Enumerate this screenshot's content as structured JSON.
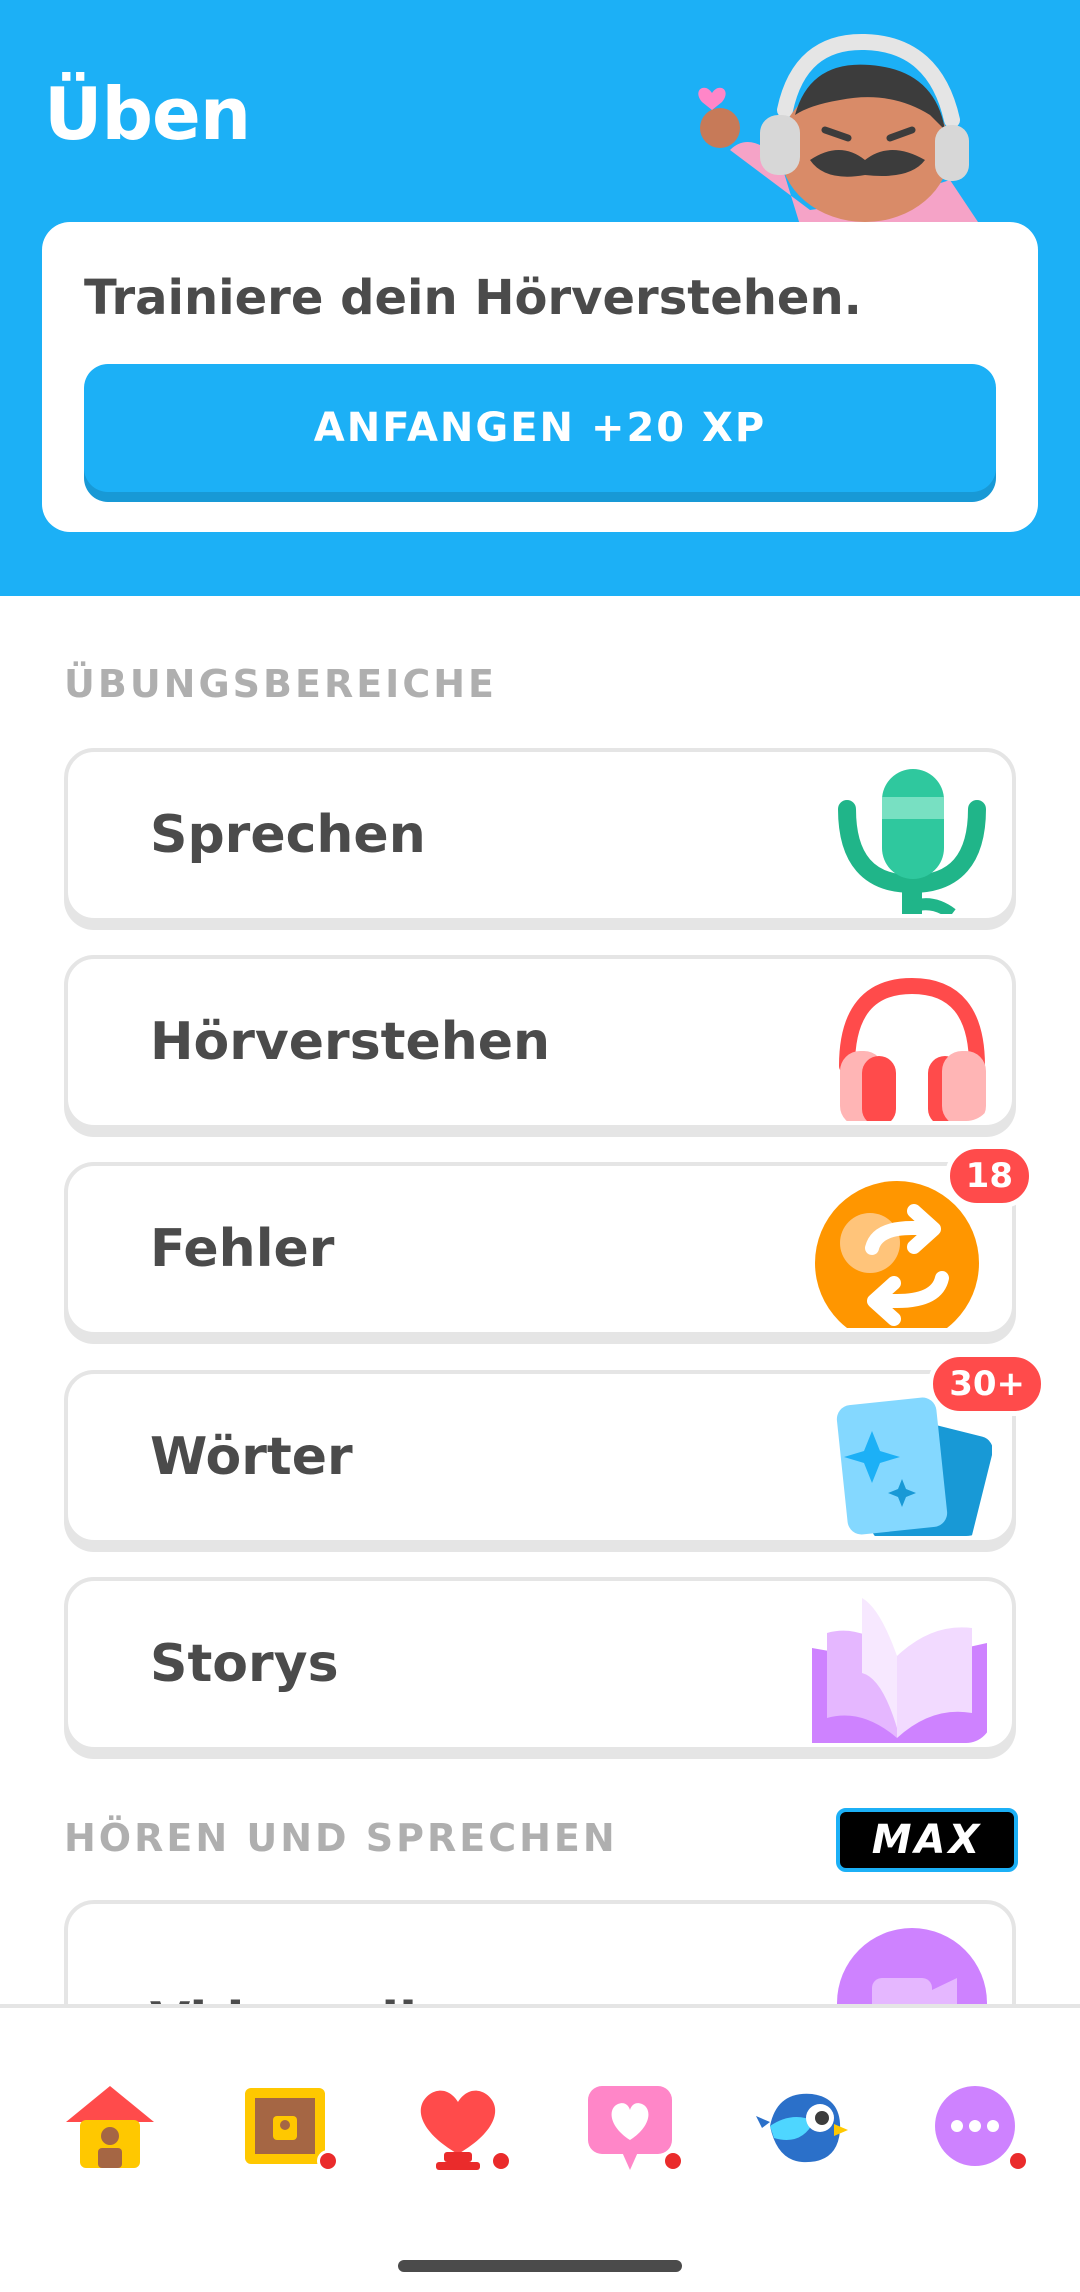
{
  "header": {
    "title": "Üben",
    "promo_text": "Trainiere dein Hörverstehen.",
    "promo_button": "ANFANGEN +20 XP"
  },
  "sections": {
    "practice_label": "ÜBUNGSBEREICHE",
    "listen_speak_label": "HÖREN UND SPRECHEN",
    "max_label": "MAX"
  },
  "cards": [
    {
      "label": "Sprechen",
      "icon": "microphone-icon"
    },
    {
      "label": "Hörverstehen",
      "icon": "headphones-icon"
    },
    {
      "label": "Fehler",
      "icon": "repeat-icon",
      "badge": "18"
    },
    {
      "label": "Wörter",
      "icon": "cards-icon",
      "badge": "30+"
    },
    {
      "label": "Storys",
      "icon": "book-icon"
    },
    {
      "label": "Videocall",
      "icon": "video-icon"
    }
  ],
  "nav": [
    {
      "name": "home",
      "icon": "house-icon"
    },
    {
      "name": "chest",
      "icon": "treasure-chest-icon"
    },
    {
      "name": "leagues",
      "icon": "heart-trophy-icon"
    },
    {
      "name": "friends",
      "icon": "heart-message-icon"
    },
    {
      "name": "practice",
      "icon": "bird-icon"
    },
    {
      "name": "more",
      "icon": "more-icon"
    }
  ],
  "colors": {
    "header_blue": "#1cb0f6",
    "button_shadow": "#1899d6",
    "badge_red": "#ff4b4b",
    "label_gray": "#afafaf",
    "text_dark": "#4b4b4b"
  }
}
